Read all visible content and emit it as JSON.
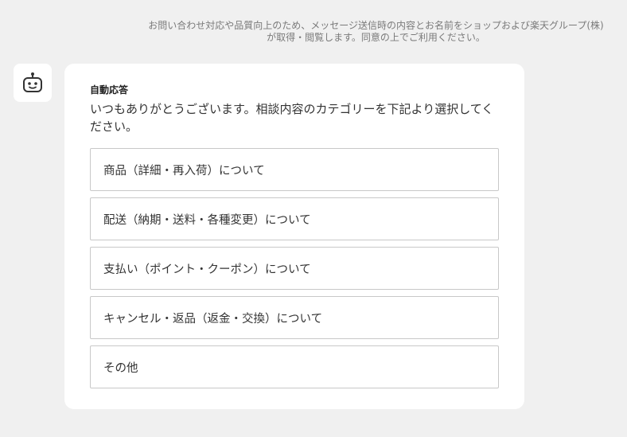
{
  "notice": {
    "line1": "お問い合わせ対応や品質向上のため、メッセージ送信時の内容とお名前をショップおよび楽天グループ(株)",
    "line2": "が取得・閲覧します。同意の上でご利用ください。"
  },
  "bot": {
    "icon": "robot-icon",
    "sender": "自動応答",
    "message": "いつもありがとうございます。相談内容のカテゴリーを下記より選択してください。"
  },
  "options": [
    "商品（詳細・再入荷）について",
    "配送（納期・送料・各種変更）について",
    "支払い（ポイント・クーポン）について",
    "キャンセル・返品（返金・交換）について",
    "その他"
  ]
}
